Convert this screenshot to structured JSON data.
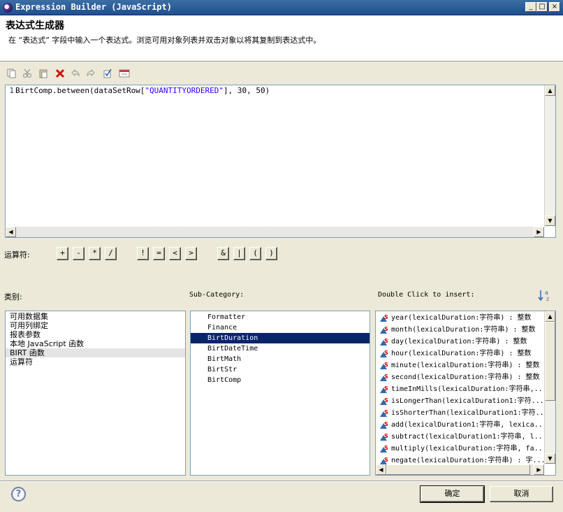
{
  "window": {
    "title": "Expression Builder (JavaScript)",
    "controls": [
      "_",
      "□",
      "×"
    ]
  },
  "header": {
    "title": "表达式生成器",
    "description": "在 “表达式” 字段中输入一个表达式。浏览可用对象列表并双击对象以将其复制到表达式中。"
  },
  "toolbar": {
    "icons": [
      "copy-icon",
      "cut-icon",
      "paste-icon",
      "delete-icon",
      "undo-icon",
      "redo-icon",
      "validate-icon",
      "calendar-icon"
    ]
  },
  "editor": {
    "line_number": "1",
    "code_prefix": "BirtComp.between(dataSetRow[",
    "code_string": "\"QUANTITYORDERED\"",
    "code_suffix": "], 30, 50)"
  },
  "operators": {
    "label": "运算符:",
    "buttons": [
      "+",
      "-",
      "*",
      "/",
      "!",
      "=",
      "<",
      ">",
      "&",
      "|",
      "(",
      ")"
    ]
  },
  "category": {
    "label": "类别:",
    "items": [
      "可用数据集",
      "可用列绑定",
      "报表参数",
      "本地 JavaScript 函数",
      "BIRT 函数",
      "运算符"
    ],
    "selected_index": 4
  },
  "subcategory": {
    "label": "Sub-Category:",
    "items": [
      "Formatter",
      "Finance",
      "BirtDuration",
      "BirtDateTime",
      "BirtMath",
      "BirtStr",
      "BirtComp"
    ],
    "selected_index": 2
  },
  "insert": {
    "label": "Double Click to insert:",
    "sort_icon": "sort-az-icon",
    "items": [
      "year(lexicalDuration:字符串) : 整数",
      "month(lexicalDuration:字符串) : 整数",
      "day(lexicalDuration:字符串) : 整数",
      "hour(lexicalDuration:字符串) : 整数",
      "minute(lexicalDuration:字符串) : 整数",
      "second(lexicalDuration:字符串) : 整数",
      "timeInMills(lexicalDuration:字符串,...",
      "isLongerThan(lexicalDuration1:字符...",
      "isShorterThan(lexicalDuration1:字符...",
      "add(lexicalDuration1:字符串, lexica...",
      "subtract(lexicalDuration1:字符串, l...",
      "multiply(lexicalDuration:字符串, fa...",
      "negate(lexicalDuration:字符串) : 字..."
    ]
  },
  "buttons": {
    "ok": "确定",
    "cancel": "取消",
    "help": "?"
  },
  "colors": {
    "selection": "#0a246a",
    "string_literal": "#2a00ff",
    "dialog_bg": "#ece9d8"
  }
}
